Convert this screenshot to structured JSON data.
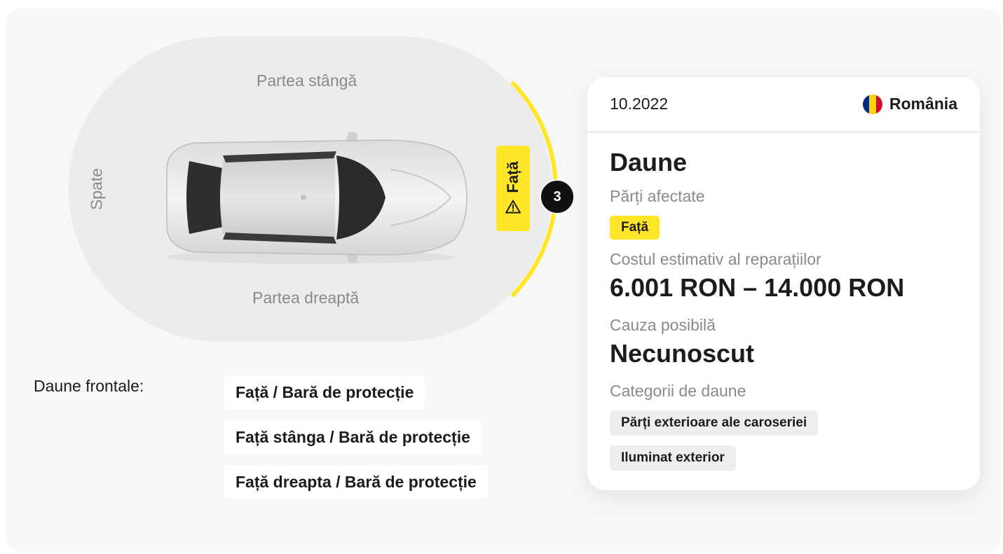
{
  "diagram": {
    "left_side": "Partea stângă",
    "right_side": "Partea dreaptă",
    "back": "Spate",
    "front_label": "Față",
    "damage_count": "3",
    "colors": {
      "highlight": "#ffe629",
      "oval": "#ececec",
      "badge": "#111111"
    },
    "icons": {
      "warning": "warning-triangle-icon"
    }
  },
  "frontal": {
    "title": "Daune frontale:",
    "items": [
      "Față / Bară de protecție",
      "Față stânga / Bară de protecție",
      "Față dreapta / Bară de protecție"
    ]
  },
  "card": {
    "date": "10.2022",
    "country": "România",
    "title": "Daune",
    "affected_parts_label": "Părți afectate",
    "affected_parts": [
      "Față"
    ],
    "repair_cost_label": "Costul estimativ al reparațiilor",
    "repair_cost": "6.001 RON – 14.000 RON",
    "cause_label": "Cauza posibilă",
    "cause": "Necunoscut",
    "categories_label": "Categorii de daune",
    "categories": [
      "Părți exterioare ale caroseriei",
      "Iluminat exterior"
    ],
    "flag_colors": [
      "#002b7f",
      "#fcd116",
      "#ce1126"
    ]
  }
}
